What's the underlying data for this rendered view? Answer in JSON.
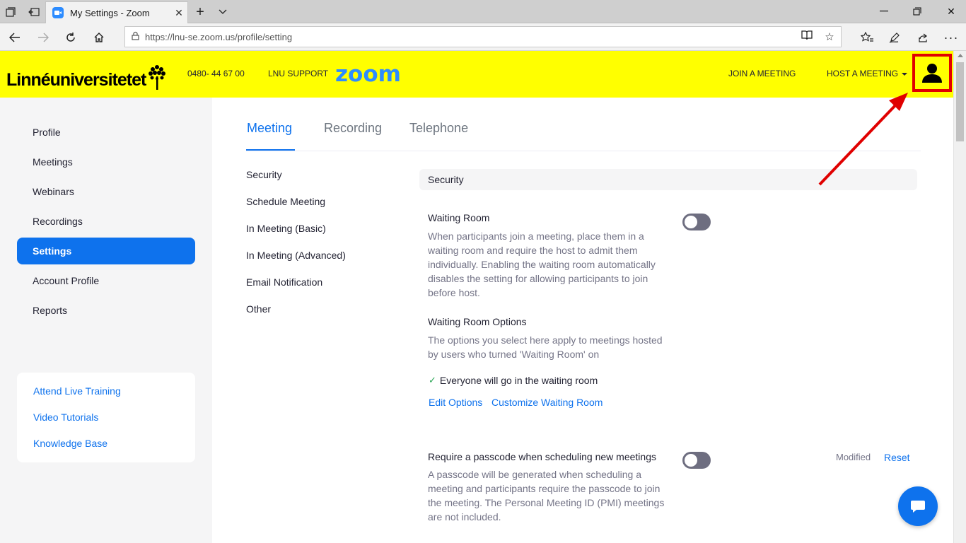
{
  "browser": {
    "tab_title": "My Settings - Zoom",
    "url": "https://lnu-se.zoom.us/profile/setting"
  },
  "header": {
    "university_name": "Linnéuniversitetet",
    "phone": "0480- 44 67 00",
    "support": "LNU SUPPORT",
    "zoom_logo": "zoom",
    "join_meeting": "JOIN A MEETING",
    "host_meeting": "HOST A MEETING"
  },
  "sidebar": {
    "items": [
      {
        "label": "Profile"
      },
      {
        "label": "Meetings"
      },
      {
        "label": "Webinars"
      },
      {
        "label": "Recordings"
      },
      {
        "label": "Settings"
      },
      {
        "label": "Account Profile"
      },
      {
        "label": "Reports"
      }
    ],
    "active": "Settings",
    "help_links": [
      {
        "label": "Attend Live Training"
      },
      {
        "label": "Video Tutorials"
      },
      {
        "label": "Knowledge Base"
      }
    ]
  },
  "main": {
    "tabs": [
      {
        "label": "Meeting"
      },
      {
        "label": "Recording"
      },
      {
        "label": "Telephone"
      }
    ],
    "active_tab": "Meeting",
    "subnav": [
      {
        "label": "Security"
      },
      {
        "label": "Schedule Meeting"
      },
      {
        "label": "In Meeting (Basic)"
      },
      {
        "label": "In Meeting (Advanced)"
      },
      {
        "label": "Email Notification"
      },
      {
        "label": "Other"
      }
    ],
    "section_title": "Security",
    "waiting_room": {
      "title": "Waiting Room",
      "description": "When participants join a meeting, place them in a waiting room and require the host to admit them individually. Enabling the waiting room automatically disables the setting for allowing participants to join before host.",
      "enabled": false
    },
    "waiting_room_options": {
      "title": "Waiting Room Options",
      "description": "The options you select here apply to meetings hosted by users who turned 'Waiting Room' on",
      "selected_option": "Everyone will go in the waiting room",
      "edit_options": "Edit Options",
      "customize": "Customize Waiting Room"
    },
    "passcode": {
      "title": "Require a passcode when scheduling new meetings",
      "description": "A passcode will be generated when scheduling a meeting and participants require the passcode to join the meeting. The Personal Meeting ID (PMI) meetings are not included.",
      "enabled": false,
      "modified": "Modified",
      "reset": "Reset"
    }
  },
  "colors": {
    "header_bg": "#ffff00",
    "accent": "#0e72ed",
    "highlight": "#e00000"
  }
}
